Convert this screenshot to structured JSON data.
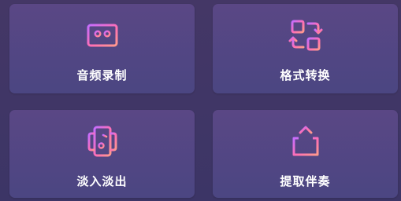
{
  "tiles": [
    {
      "label": "音频录制",
      "icon": "cassette-icon"
    },
    {
      "label": "格式转换",
      "icon": "convert-icon"
    },
    {
      "label": "淡入淡出",
      "icon": "fade-music-icon"
    },
    {
      "label": "提取伴奏",
      "icon": "share-upload-icon"
    }
  ],
  "colors": {
    "background": "#443766",
    "tile": "#52467f",
    "icon_gradient_start": "#ff7ab8",
    "icon_gradient_end": "#a57bff",
    "label": "#ffffff"
  }
}
